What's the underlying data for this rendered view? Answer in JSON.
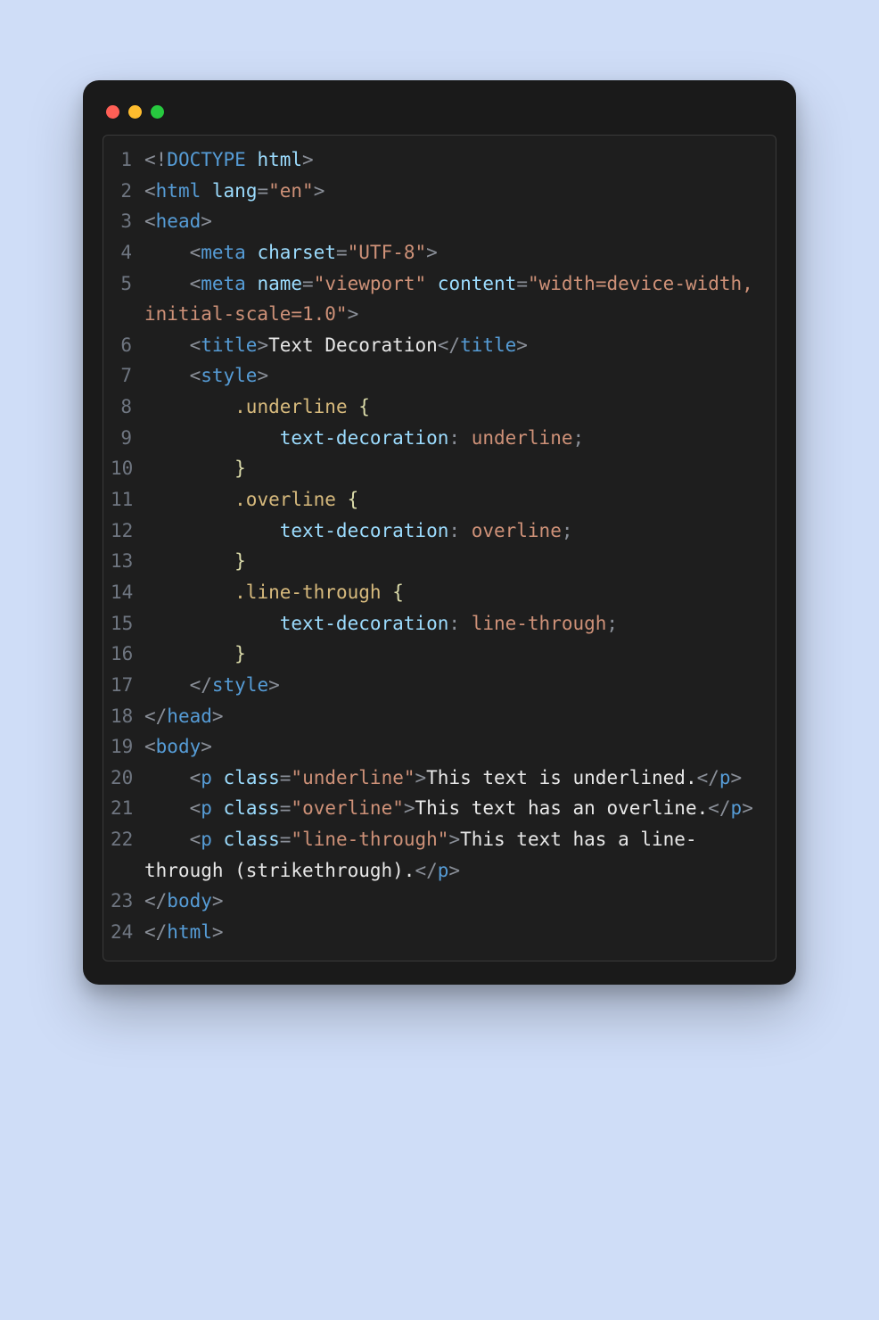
{
  "lines": [
    {
      "n": "1",
      "html": "<span class='p'>&lt;!</span><span class='dt'>DOCTYPE</span> <span class='attr'>html</span><span class='p'>&gt;</span>"
    },
    {
      "n": "2",
      "html": "<span class='p'>&lt;</span><span class='tag'>html</span> <span class='attr'>lang</span><span class='p'>=</span><span class='val'>\"en\"</span><span class='p'>&gt;</span>"
    },
    {
      "n": "3",
      "html": "<span class='p'>&lt;</span><span class='tag'>head</span><span class='p'>&gt;</span>"
    },
    {
      "n": "4",
      "html": "    <span class='p'>&lt;</span><span class='tag'>meta</span> <span class='attr'>charset</span><span class='p'>=</span><span class='val'>\"UTF-8\"</span><span class='p'>&gt;</span>"
    },
    {
      "n": "5",
      "html": "    <span class='p'>&lt;</span><span class='tag'>meta</span> <span class='attr'>name</span><span class='p'>=</span><span class='val'>\"viewport\"</span> <span class='attr'>content</span><span class='p'>=</span><span class='val'>\"width=device-width, initial-scale=1.0\"</span><span class='p'>&gt;</span>"
    },
    {
      "n": "6",
      "html": "    <span class='p'>&lt;</span><span class='tag'>title</span><span class='p'>&gt;</span><span class='txt'>Text Decoration</span><span class='p'>&lt;/</span><span class='tag'>title</span><span class='p'>&gt;</span>"
    },
    {
      "n": "7",
      "html": "    <span class='p'>&lt;</span><span class='tag'>style</span><span class='p'>&gt;</span>"
    },
    {
      "n": "8",
      "html": "        <span class='sel'>.underline</span> <span class='brace'>{</span>"
    },
    {
      "n": "9",
      "html": "            <span class='prop'>text-decoration</span><span class='p'>:</span> <span class='cval'>underline</span><span class='p'>;</span>"
    },
    {
      "n": "10",
      "html": "        <span class='brace'>}</span>"
    },
    {
      "n": "11",
      "html": "        <span class='sel'>.overline</span> <span class='brace'>{</span>"
    },
    {
      "n": "12",
      "html": "            <span class='prop'>text-decoration</span><span class='p'>:</span> <span class='cval'>overline</span><span class='p'>;</span>"
    },
    {
      "n": "13",
      "html": "        <span class='brace'>}</span>"
    },
    {
      "n": "14",
      "html": "        <span class='sel'>.line-through</span> <span class='brace'>{</span>"
    },
    {
      "n": "15",
      "html": "            <span class='prop'>text-decoration</span><span class='p'>:</span> <span class='cval'>line-through</span><span class='p'>;</span>"
    },
    {
      "n": "16",
      "html": "        <span class='brace'>}</span>"
    },
    {
      "n": "17",
      "html": "    <span class='p'>&lt;/</span><span class='tag'>style</span><span class='p'>&gt;</span>"
    },
    {
      "n": "18",
      "html": "<span class='p'>&lt;/</span><span class='tag'>head</span><span class='p'>&gt;</span>"
    },
    {
      "n": "19",
      "html": "<span class='p'>&lt;</span><span class='tag'>body</span><span class='p'>&gt;</span>"
    },
    {
      "n": "20",
      "html": "    <span class='p'>&lt;</span><span class='tag'>p</span> <span class='attr'>class</span><span class='p'>=</span><span class='val'>\"underline\"</span><span class='p'>&gt;</span><span class='txt'>This text is underlined.</span><span class='p'>&lt;/</span><span class='tag'>p</span><span class='p'>&gt;</span>"
    },
    {
      "n": "21",
      "html": "    <span class='p'>&lt;</span><span class='tag'>p</span> <span class='attr'>class</span><span class='p'>=</span><span class='val'>\"overline\"</span><span class='p'>&gt;</span><span class='txt'>This text has an overline.</span><span class='p'>&lt;/</span><span class='tag'>p</span><span class='p'>&gt;</span>"
    },
    {
      "n": "22",
      "html": "    <span class='p'>&lt;</span><span class='tag'>p</span> <span class='attr'>class</span><span class='p'>=</span><span class='val'>\"line-through\"</span><span class='p'>&gt;</span><span class='txt'>This text has a line-through (strikethrough).</span><span class='p'>&lt;/</span><span class='tag'>p</span><span class='p'>&gt;</span>"
    },
    {
      "n": "23",
      "html": "<span class='p'>&lt;/</span><span class='tag'>body</span><span class='p'>&gt;</span>"
    },
    {
      "n": "24",
      "html": "<span class='p'>&lt;/</span><span class='tag'>html</span><span class='p'>&gt;</span>"
    }
  ]
}
